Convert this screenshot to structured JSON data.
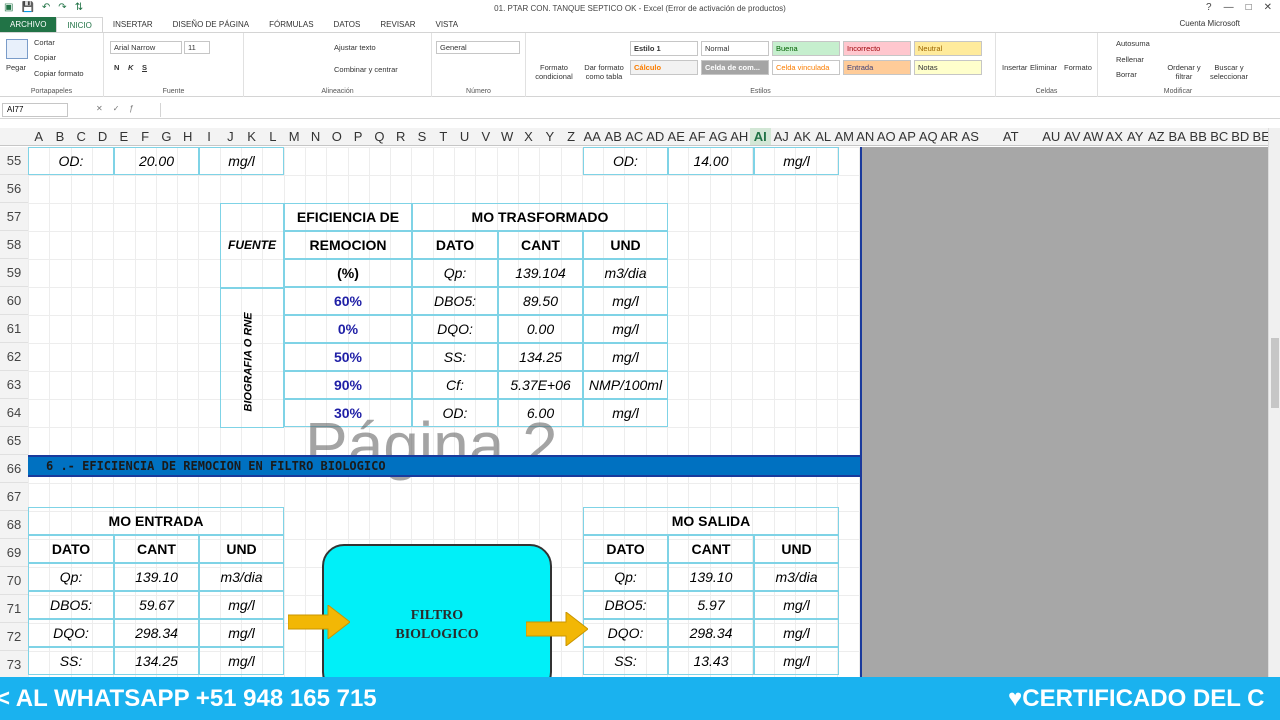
{
  "window": {
    "title": "01. PTAR CON. TANQUE SEPTICO OK - Excel (Error de activación de productos)",
    "account": "Cuenta Microsoft",
    "controls": [
      "?",
      "—",
      "□",
      "✕"
    ]
  },
  "tabs": [
    "ARCHIVO",
    "INICIO",
    "INSERTAR",
    "DISEÑO DE PÁGINA",
    "FÓRMULAS",
    "DATOS",
    "REVISAR",
    "VISTA"
  ],
  "ribbon": {
    "clipboard": {
      "paste": "Pegar",
      "cut": "Cortar",
      "copy": "Copiar",
      "format_painter": "Copiar formato",
      "label": "Portapapeles"
    },
    "font": {
      "name": "Arial Narrow",
      "size": "11",
      "bold": "N",
      "italic": "K",
      "underline": "S",
      "label": "Fuente"
    },
    "alignment": {
      "wrap": "Ajustar texto",
      "merge": "Combinar y centrar",
      "label": "Alineación"
    },
    "number": {
      "format": "General",
      "label": "Número"
    },
    "styles": {
      "cond_format": "Formato condicional",
      "format_table": "Dar formato como tabla",
      "cells": [
        "Estilo 1",
        "Normal",
        "Buena",
        "Incorrecto",
        "Neutral",
        "Cálculo",
        "Celda de com...",
        "Celda vinculada",
        "Entrada",
        "Notas"
      ],
      "label": "Estilos"
    },
    "cells": {
      "insert": "Insertar",
      "delete": "Eliminar",
      "format": "Formato",
      "label": "Celdas"
    },
    "editing": {
      "autosum": "Autosuma",
      "fill": "Rellenar",
      "clear": "Borrar",
      "sort": "Ordenar y filtrar",
      "find": "Buscar y seleccionar",
      "label": "Modificar"
    }
  },
  "formula_bar": {
    "name_box": "AI77",
    "value": ""
  },
  "columns": [
    "A",
    "B",
    "C",
    "D",
    "E",
    "F",
    "G",
    "H",
    "I",
    "J",
    "K",
    "L",
    "M",
    "N",
    "O",
    "P",
    "Q",
    "R",
    "S",
    "T",
    "U",
    "V",
    "W",
    "X",
    "Y",
    "Z",
    "AA",
    "AB",
    "AC",
    "AD",
    "AE",
    "AF",
    "AG",
    "AH",
    "AI",
    "AJ",
    "AK",
    "AL",
    "AM",
    "AN",
    "AO",
    "AP",
    "AQ",
    "AR",
    "AS",
    "AT",
    "AU",
    "AV",
    "AW",
    "AX",
    "AY",
    "AZ",
    "BA",
    "BB",
    "BC",
    "BD",
    "BE"
  ],
  "rows": [
    "55",
    "56",
    "57",
    "58",
    "59",
    "60",
    "61",
    "62",
    "63",
    "64",
    "65",
    "66",
    "67",
    "68",
    "69",
    "70",
    "71",
    "72",
    "73"
  ],
  "row55": {
    "left": [
      "OD:",
      "20.00",
      "mg/l"
    ],
    "right": [
      "OD:",
      "14.00",
      "mg/l"
    ]
  },
  "eff_table": {
    "fuente": "FUENTE",
    "eff_header1": "EFICIENCIA DE",
    "eff_header2": "REMOCION",
    "eff_header3": "(%)",
    "mo_header": "MO TRASFORMADO",
    "cols": [
      "DATO",
      "CANT",
      "UND"
    ],
    "source_vertical": "BIOGRAFIA O RNE",
    "rows": [
      {
        "eff": "",
        "dato": "Qp:",
        "cant": "139.104",
        "und": "m3/dia"
      },
      {
        "eff": "60%",
        "dato": "DBO5:",
        "cant": "89.50",
        "und": "mg/l"
      },
      {
        "eff": "0%",
        "dato": "DQO:",
        "cant": "0.00",
        "und": "mg/l"
      },
      {
        "eff": "50%",
        "dato": "SS:",
        "cant": "134.25",
        "und": "mg/l"
      },
      {
        "eff": "90%",
        "dato": "Cf:",
        "cant": "5.37E+06",
        "und": "NMP/100ml"
      },
      {
        "eff": "30%",
        "dato": "OD:",
        "cant": "6.00",
        "und": "mg/l"
      }
    ]
  },
  "watermark": "Página 2",
  "section_band": "6   .- EFICIENCIA DE REMOCION EN FILTRO BIOLOGICO",
  "mo_entrada": {
    "title": "MO ENTRADA",
    "cols": [
      "DATO",
      "CANT",
      "UND"
    ],
    "rows": [
      [
        "Qp:",
        "139.10",
        "m3/dia"
      ],
      [
        "DBO5:",
        "59.67",
        "mg/l"
      ],
      [
        "DQO:",
        "298.34",
        "mg/l"
      ],
      [
        "SS:",
        "134.25",
        "mg/l"
      ]
    ]
  },
  "mo_salida": {
    "title": "MO SALIDA",
    "cols": [
      "DATO",
      "CANT",
      "UND"
    ],
    "rows": [
      [
        "Qp:",
        "139.10",
        "m3/dia"
      ],
      [
        "DBO5:",
        "5.97",
        "mg/l"
      ],
      [
        "DQO:",
        "298.34",
        "mg/l"
      ],
      [
        "SS:",
        "13.43",
        "mg/l"
      ]
    ]
  },
  "filter": {
    "line1": "FILTRO",
    "line2": "BIOLOGICO"
  },
  "banner": {
    "left": "< AL WHATSAPP +51 948 165 715",
    "right": "♥CERTIFICADO DEL C"
  },
  "colors": {
    "accent": "#217346",
    "border": "#7fd3e6",
    "band": "#0071c1",
    "filter": "#00f0f8",
    "arrow": "#f2b705",
    "banner": "#1ab2ef",
    "pct": "#1f1fa6"
  }
}
